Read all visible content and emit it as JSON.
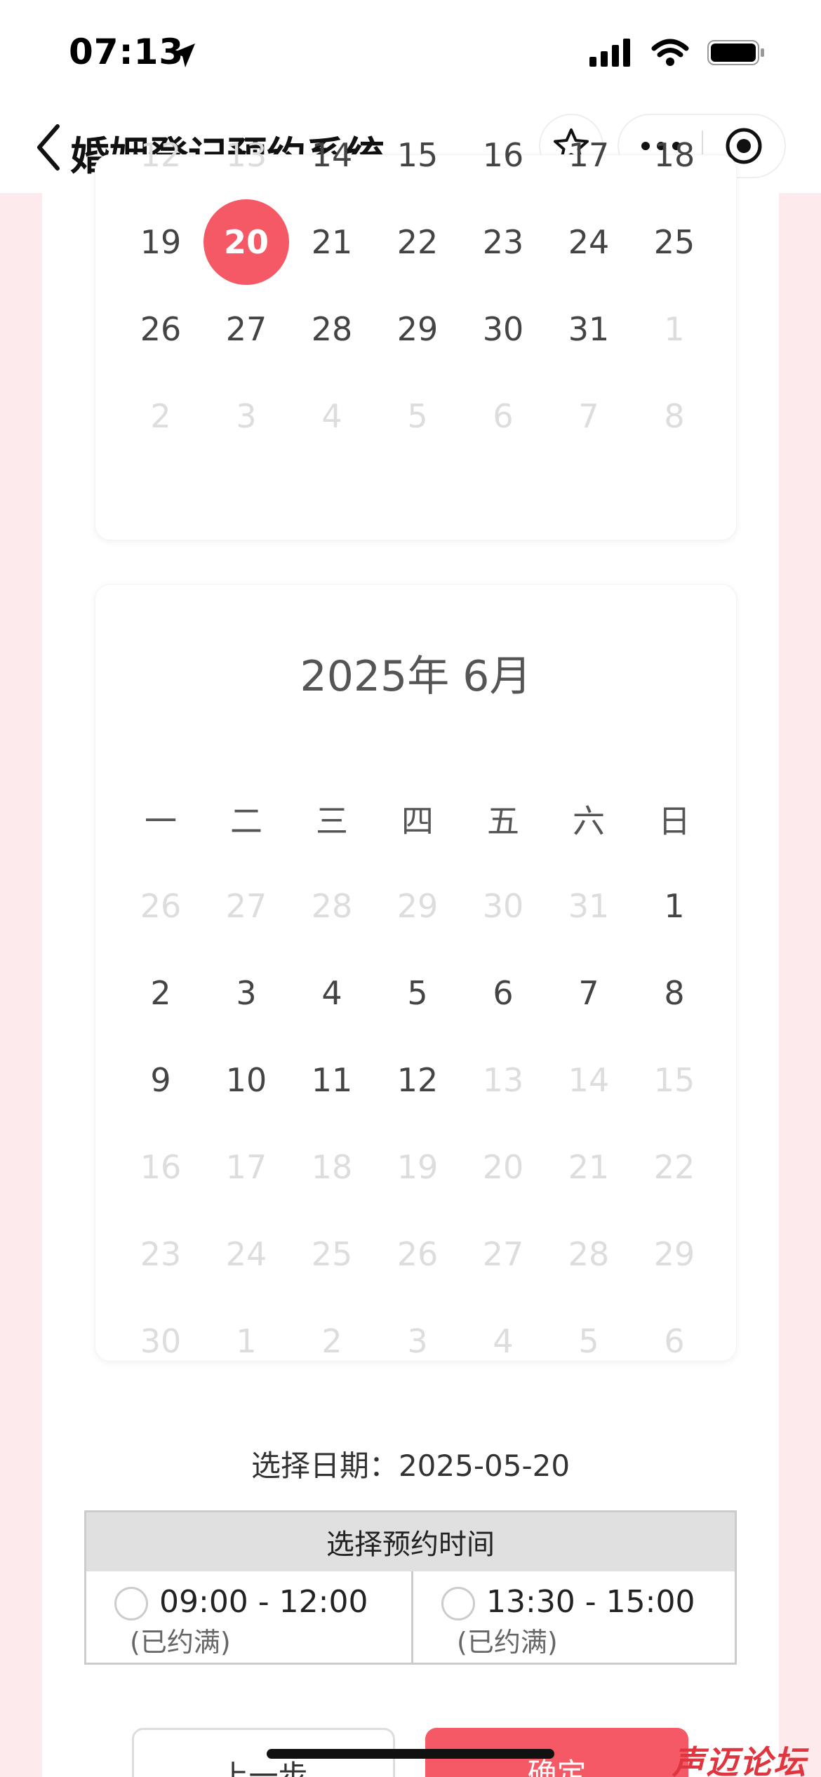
{
  "status_bar": {
    "time": "07:13"
  },
  "nav": {
    "title": "婚姻登记预约系统"
  },
  "may_calendar": {
    "rows": [
      [
        {
          "d": "12",
          "m": true
        },
        {
          "d": "13",
          "m": true
        },
        {
          "d": "14"
        },
        {
          "d": "15"
        },
        {
          "d": "16"
        },
        {
          "d": "17"
        },
        {
          "d": "18"
        }
      ],
      [
        {
          "d": "19"
        },
        {
          "d": "20",
          "sel": true
        },
        {
          "d": "21"
        },
        {
          "d": "22"
        },
        {
          "d": "23"
        },
        {
          "d": "24"
        },
        {
          "d": "25"
        }
      ],
      [
        {
          "d": "26"
        },
        {
          "d": "27"
        },
        {
          "d": "28"
        },
        {
          "d": "29"
        },
        {
          "d": "30"
        },
        {
          "d": "31"
        },
        {
          "d": "1",
          "m": true
        }
      ],
      [
        {
          "d": "2",
          "m": true
        },
        {
          "d": "3",
          "m": true
        },
        {
          "d": "4",
          "m": true
        },
        {
          "d": "5",
          "m": true
        },
        {
          "d": "6",
          "m": true
        },
        {
          "d": "7",
          "m": true
        },
        {
          "d": "8",
          "m": true
        }
      ]
    ]
  },
  "june_calendar": {
    "title": "2025年 6月",
    "weekdays": [
      "一",
      "二",
      "三",
      "四",
      "五",
      "六",
      "日"
    ],
    "rows": [
      [
        {
          "d": "26",
          "m": true
        },
        {
          "d": "27",
          "m": true
        },
        {
          "d": "28",
          "m": true
        },
        {
          "d": "29",
          "m": true
        },
        {
          "d": "30",
          "m": true
        },
        {
          "d": "31",
          "m": true
        },
        {
          "d": "1"
        }
      ],
      [
        {
          "d": "2"
        },
        {
          "d": "3"
        },
        {
          "d": "4"
        },
        {
          "d": "5"
        },
        {
          "d": "6"
        },
        {
          "d": "7"
        },
        {
          "d": "8"
        }
      ],
      [
        {
          "d": "9"
        },
        {
          "d": "10"
        },
        {
          "d": "11"
        },
        {
          "d": "12"
        },
        {
          "d": "13",
          "m": true
        },
        {
          "d": "14",
          "m": true
        },
        {
          "d": "15",
          "m": true
        }
      ],
      [
        {
          "d": "16",
          "m": true
        },
        {
          "d": "17",
          "m": true
        },
        {
          "d": "18",
          "m": true
        },
        {
          "d": "19",
          "m": true
        },
        {
          "d": "20",
          "m": true
        },
        {
          "d": "21",
          "m": true
        },
        {
          "d": "22",
          "m": true
        }
      ],
      [
        {
          "d": "23",
          "m": true
        },
        {
          "d": "24",
          "m": true
        },
        {
          "d": "25",
          "m": true
        },
        {
          "d": "26",
          "m": true
        },
        {
          "d": "27",
          "m": true
        },
        {
          "d": "28",
          "m": true
        },
        {
          "d": "29",
          "m": true
        }
      ],
      [
        {
          "d": "30",
          "m": true
        },
        {
          "d": "1",
          "m": true
        },
        {
          "d": "2",
          "m": true
        },
        {
          "d": "3",
          "m": true
        },
        {
          "d": "4",
          "m": true
        },
        {
          "d": "5",
          "m": true
        },
        {
          "d": "6",
          "m": true
        }
      ]
    ]
  },
  "selection": {
    "label": "选择日期：2025-05-20"
  },
  "time_table": {
    "header": "选择预约时间",
    "slots": [
      {
        "time": "09:00 - 12:00",
        "status": "(已约满)"
      },
      {
        "time": "13:30 - 15:00",
        "status": "(已约满)"
      }
    ]
  },
  "buttons": {
    "prev": "上一步",
    "confirm": "确定"
  },
  "watermark": "声迈论坛",
  "colors": {
    "accent": "#f65966",
    "page_bg": "#fdeaec",
    "muted_day": "#dddddd"
  }
}
